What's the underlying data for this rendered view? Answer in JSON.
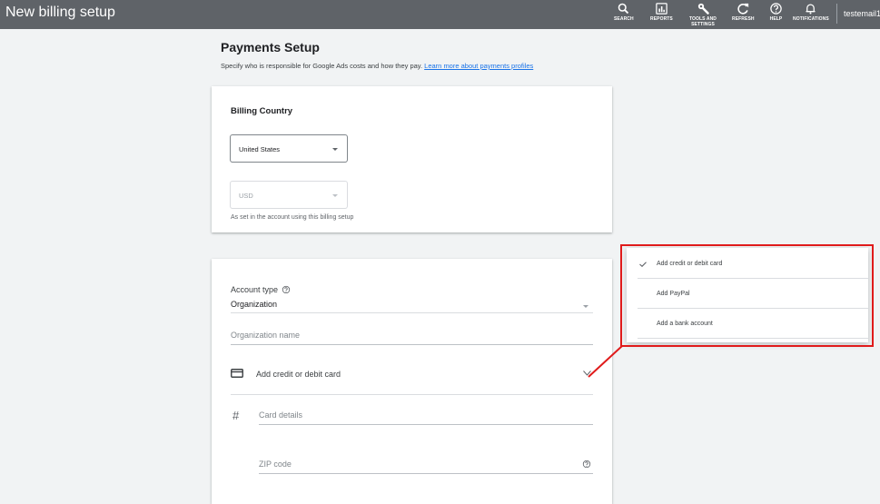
{
  "topbar": {
    "title": "New billing setup",
    "items": [
      {
        "label": "SEARCH",
        "icon": "search-icon"
      },
      {
        "label": "REPORTS",
        "icon": "reports-icon"
      },
      {
        "label": "TOOLS AND SETTINGS",
        "icon": "wrench-icon"
      },
      {
        "label": "REFRESH",
        "icon": "refresh-icon"
      },
      {
        "label": "HELP",
        "icon": "help-icon"
      },
      {
        "label": "NOTIFICATIONS",
        "icon": "bell-icon"
      }
    ],
    "user": "testemail1"
  },
  "header": {
    "title": "Payments Setup",
    "description": "Specify who is responsible for Google Ads costs and how they pay.",
    "link": "Learn more about payments profiles"
  },
  "billing_country": {
    "title": "Billing Country",
    "country_value": "United States",
    "currency_value": "USD",
    "helper": "As set in the account using this billing setup"
  },
  "account": {
    "type_label": "Account type",
    "type_value": "Organization",
    "org_name_placeholder": "Organization name",
    "payment_method": "Add credit or debit card",
    "card_details_placeholder": "Card details",
    "zip_placeholder": "ZIP code"
  },
  "payment_menu": {
    "items": [
      {
        "label": "Add credit or debit card",
        "selected": true
      },
      {
        "label": "Add PayPal",
        "selected": false
      },
      {
        "label": "Add a bank account",
        "selected": false
      }
    ]
  },
  "colors": {
    "topbar": "#5f6368",
    "link": "#1a73e8",
    "highlight": "#e01b1b"
  }
}
